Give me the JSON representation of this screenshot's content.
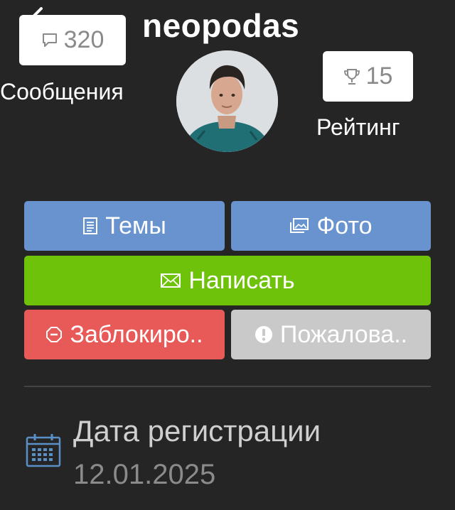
{
  "header": {
    "back_icon": "back-arrow-icon",
    "username": "neopodas"
  },
  "stats": {
    "messages": {
      "count": "320",
      "label": "Сообщения",
      "icon": "speech-bubble-icon"
    },
    "rating": {
      "count": "15",
      "label": "Рейтинг",
      "icon": "trophy-icon"
    }
  },
  "avatar": {
    "icon": "user-avatar"
  },
  "actions": {
    "topics": {
      "label": "Темы",
      "icon": "document-icon",
      "color": "#6993cf"
    },
    "photo": {
      "label": "Фото",
      "icon": "photos-icon",
      "color": "#6993cf"
    },
    "write": {
      "label": "Написать",
      "icon": "envelope-icon",
      "color": "#6ec30a"
    },
    "block": {
      "label": "Заблокиро..",
      "icon": "octagon-stop-icon",
      "color": "#e85a58"
    },
    "report": {
      "label": "Пожалова..",
      "icon": "exclamation-circle-icon",
      "color": "#c9c9c9"
    }
  },
  "registration": {
    "title": "Дата регистрации",
    "date": "12.01.2025",
    "icon": "calendar-icon"
  }
}
